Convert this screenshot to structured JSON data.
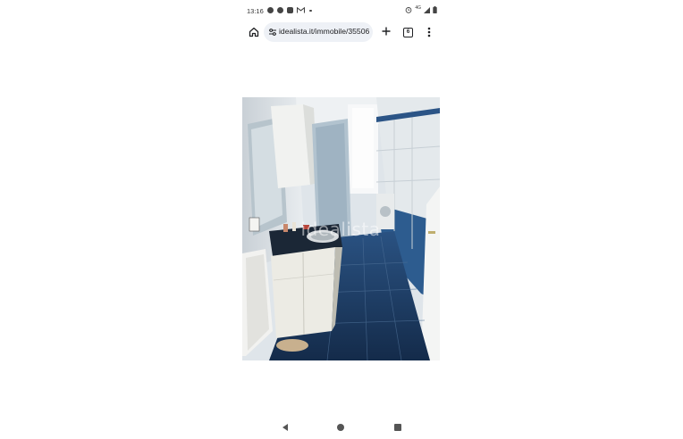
{
  "status_bar": {
    "time": "13:16",
    "network": "4G",
    "notification_icons": [
      "facebook-icon",
      "facebook-icon",
      "app-icon",
      "gmail-icon",
      "more-dot-icon"
    ],
    "right_icons": [
      "alarm-icon",
      "signal-icon",
      "battery-icon"
    ]
  },
  "browser": {
    "url": "idealista.it/immobile/35506",
    "tab_count": "6",
    "icons": [
      "home-icon",
      "tune-icon",
      "plus-icon",
      "tabs-icon",
      "more-vert-icon"
    ]
  },
  "photo": {
    "watermark": "idealista",
    "subject": "bathroom"
  },
  "nav_bar": {
    "icons": [
      "back-icon",
      "home-circle-icon",
      "recents-icon"
    ]
  },
  "colors": {
    "tile_blue": "#1f3f6b",
    "wall_white": "#e6ebef",
    "chrome_bg": "#ffffff",
    "urlbar_bg": "#eef1f6"
  }
}
